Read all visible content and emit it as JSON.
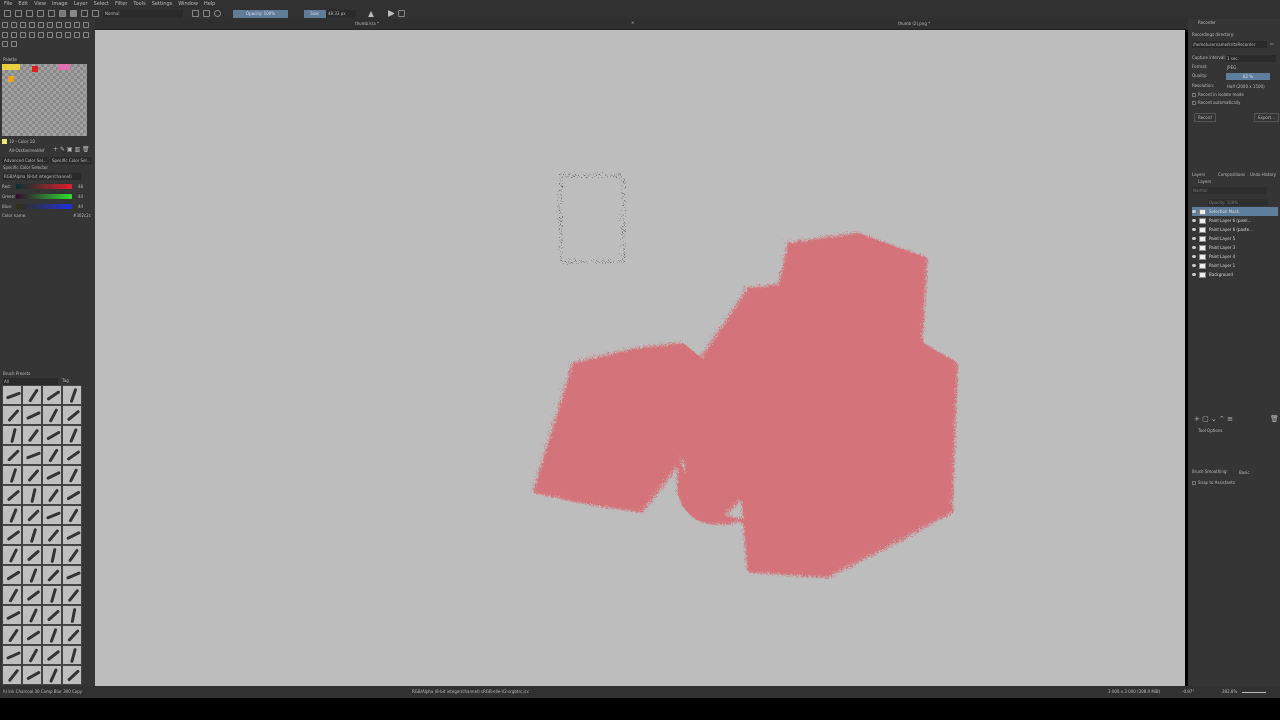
{
  "menu": [
    "File",
    "Edit",
    "View",
    "Image",
    "Layer",
    "Select",
    "Filter",
    "Tools",
    "Settings",
    "Window",
    "Help"
  ],
  "toolbar": {
    "blend_mode": "Normal",
    "opacity": "Opacity: 100%",
    "size_label": "Size:",
    "size_value": "48.33 px"
  },
  "tabs": {
    "doc1": "thumb.kra *",
    "doc2": "thumb (2).png *"
  },
  "palette": {
    "title": "Palette",
    "current": "10 - Color 10",
    "name": "All-Ozstanirealdef"
  },
  "color_tabs": [
    "Advanced Color Sel...",
    "Specific Color Sel..."
  ],
  "color_selector": {
    "title": "Specific Color Selector",
    "model": "RGB/Alpha (8-bit integer/channel)",
    "red_label": "Red:",
    "red": "48",
    "green_label": "Green:",
    "green": "44",
    "blue_label": "Blue:",
    "blue": "44",
    "colorname_label": "Color name:",
    "colorname": "#302c2c",
    "colors": {
      "red": "#e0202a",
      "green": "#30e030",
      "blue": "#2030e0"
    }
  },
  "brush_presets": {
    "title": "Brush Presets",
    "filter": "All",
    "tag": "Tag"
  },
  "recorder": {
    "title": "Recorder",
    "dir_label": "Recordings directory:",
    "dir": "/home/username/kritaRecorder",
    "interval_label": "Capture interval:",
    "interval": "1 sec.",
    "format_label": "Format:",
    "format": "JPEG",
    "quality_label": "Quality:",
    "quality": "82 %",
    "quality_value": 82,
    "resolution_label": "Resolution:",
    "resolution": "Half (2000 x 1500)",
    "isolate": "Record in isolate mode",
    "auto": "Record automatically",
    "record": "Record",
    "export": "Export..."
  },
  "layers": {
    "tabs": [
      "Layers",
      "Compositions",
      "Undo History"
    ],
    "title": "Layers",
    "blend": "Normal",
    "opacity": "Opacity: 100%",
    "items": [
      "Selection Mask",
      "Paint Layer 6 (pixel...",
      "Paint Layer 6 (paste...",
      "Paint Layer 5",
      "Paint Layer 3",
      "Paint Layer 4",
      "Paint Layer 1",
      "Background"
    ]
  },
  "tool_options": {
    "title": "Tool Options",
    "smoothing_label": "Brush Smoothing:",
    "smoothing": "Basic",
    "snap": "Snap to Assistants"
  },
  "status": {
    "brush": "h) Ink Charcoal 30 Comp Blur 300 Copy",
    "colorspace": "RGB/Alpha (8-bit integer/channel)  sRGB-elle-V2-srgbtrc.icc",
    "size": "3 000 x 3 000 (308.9 MiB)",
    "rotation": "-0.97°",
    "zoom": "282.8%"
  },
  "colors": {
    "stroke": "#d66f76",
    "canvas": "#bdbdbd",
    "accent": "#5d7e9c"
  }
}
